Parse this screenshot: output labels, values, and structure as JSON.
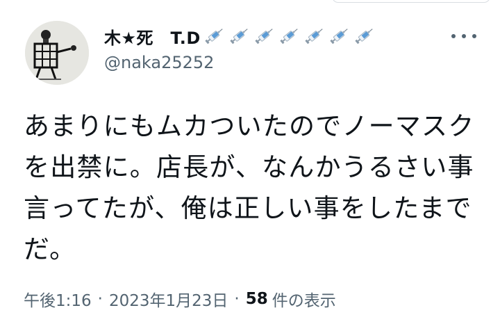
{
  "user": {
    "display_name": "木★死　T.D",
    "handle": "@naka25252",
    "name_emojis": [
      "syringe-icon",
      "syringe-icon",
      "syringe-icon",
      "syringe-icon",
      "syringe-icon",
      "syringe-icon",
      "syringe-icon"
    ]
  },
  "tweet": {
    "text": "あまりにもムカついたのでノーマスクを出禁に。店長が、なんかうるさい事言ってたが、俺は正しい事をしたまでだ。"
  },
  "meta": {
    "time": "午後1:16",
    "separator": "·",
    "date": "2023年1月23日",
    "views_count": "58",
    "views_label": "件の表示"
  },
  "colors": {
    "text_primary": "#0f1419",
    "text_secondary": "#536471",
    "syringe_blue": "#5b9bd5"
  }
}
